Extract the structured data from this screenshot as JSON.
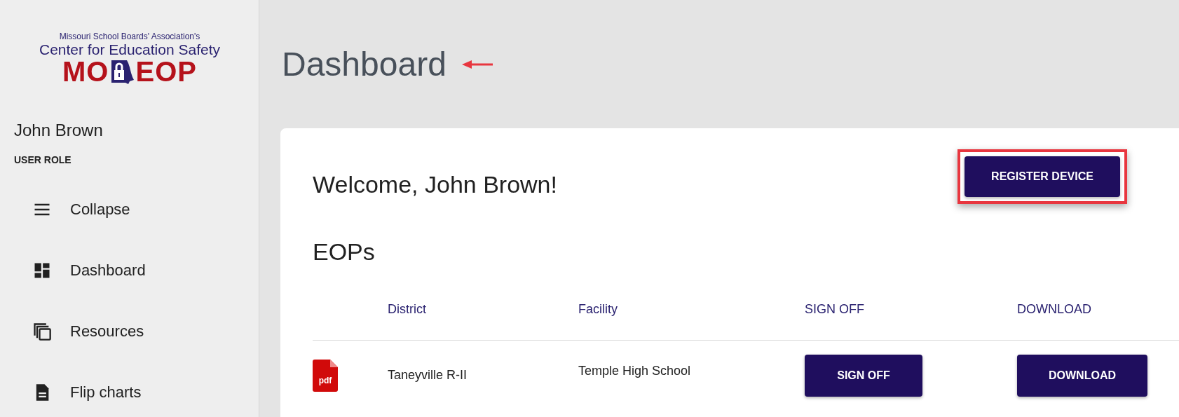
{
  "logo": {
    "line_1": "Missouri School Boards' Association's",
    "line_2": "Center for Education Safety",
    "mark_left": "MO",
    "mark_right": "EOP"
  },
  "sidebar": {
    "user_name": "John Brown",
    "user_role": "USER ROLE",
    "items": [
      {
        "label": "Collapse"
      },
      {
        "label": "Dashboard"
      },
      {
        "label": "Resources"
      },
      {
        "label": "Flip charts"
      }
    ]
  },
  "page_title": "Dashboard",
  "card": {
    "welcome": "Welcome, John Brown!",
    "register_button": "REGISTER DEVICE",
    "section_title": "EOPs",
    "table": {
      "columns": [
        "District",
        "Facility",
        "SIGN OFF",
        "DOWNLOAD"
      ],
      "rows": [
        {
          "file_type": "pdf",
          "district": "Taneyville R-II",
          "facility": "Temple High School",
          "sign_off_button": "SIGN OFF",
          "download_button": "DOWNLOAD"
        }
      ]
    }
  }
}
